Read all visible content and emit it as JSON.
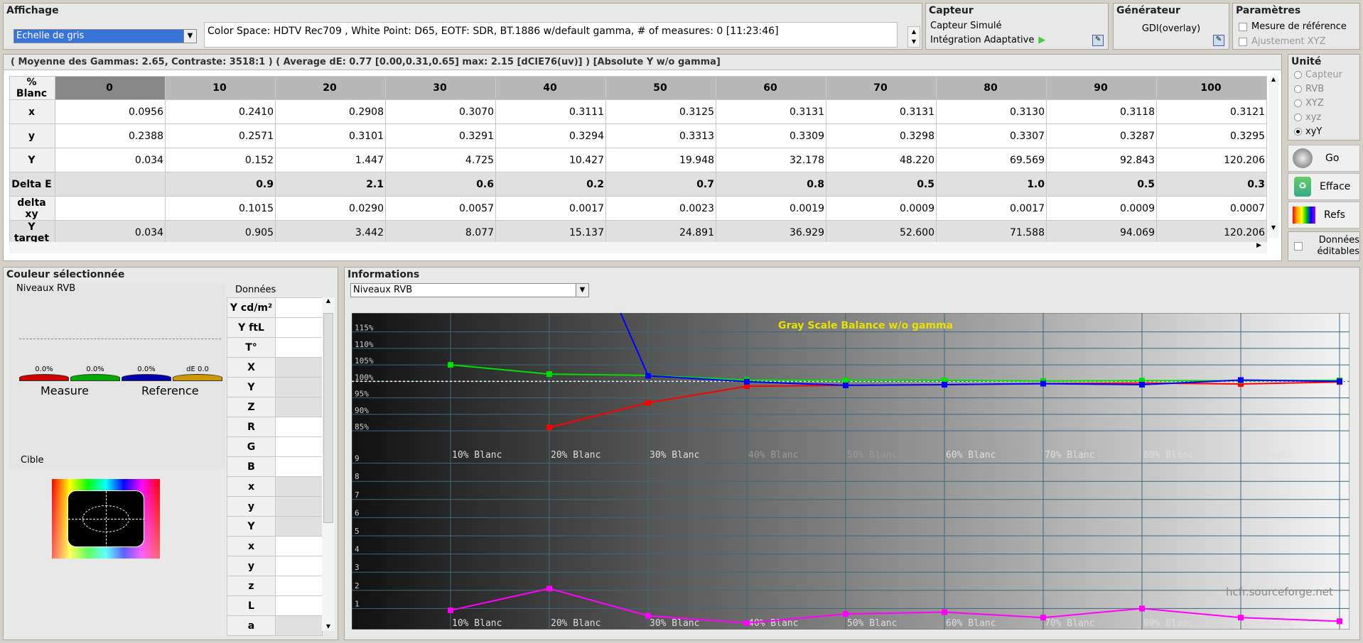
{
  "affichage": {
    "title": "Affichage",
    "combo": "Echelle de gris",
    "info": "Color Space: HDTV Rec709 , White Point: D65, EOTF:  SDR, BT.1886 w/default gamma, # of measures: 0 [11:23:46]"
  },
  "capteur": {
    "title": "Capteur",
    "line1": "Capteur Simulé",
    "line2": "Intégration Adaptative"
  },
  "generateur": {
    "title": "Générateur",
    "value": "GDI(overlay)"
  },
  "parametres": {
    "title": "Paramètres",
    "opt1": "Mesure de référence",
    "opt2": "Ajustement XYZ"
  },
  "summary": "( Moyenne des Gammas: 2.65, Contraste: 3518:1 ) ( Average dE: 0.77 [0.00,0.31,0.65] max: 2.15 [dCIE76(uv)] ) [Absolute Y w/o gamma]",
  "table": {
    "corner": "% Blanc",
    "cols": [
      "0",
      "10",
      "20",
      "30",
      "40",
      "50",
      "60",
      "70",
      "80",
      "90",
      "100"
    ],
    "rows": [
      {
        "h": "x",
        "v": [
          "0.0956",
          "0.2410",
          "0.2908",
          "0.3070",
          "0.3111",
          "0.3125",
          "0.3131",
          "0.3131",
          "0.3130",
          "0.3118",
          "0.3121"
        ]
      },
      {
        "h": "y",
        "v": [
          "0.2388",
          "0.2571",
          "0.3101",
          "0.3291",
          "0.3294",
          "0.3313",
          "0.3309",
          "0.3298",
          "0.3307",
          "0.3287",
          "0.3295"
        ]
      },
      {
        "h": "Y",
        "v": [
          "0.034",
          "0.152",
          "1.447",
          "4.725",
          "10.427",
          "19.948",
          "32.178",
          "48.220",
          "69.569",
          "92.843",
          "120.206"
        ]
      },
      {
        "h": "Delta E",
        "v": [
          "",
          "0.9",
          "2.1",
          "0.6",
          "0.2",
          "0.7",
          "0.8",
          "0.5",
          "1.0",
          "0.5",
          "0.3"
        ]
      },
      {
        "h": "delta xy",
        "v": [
          "",
          "0.1015",
          "0.0290",
          "0.0057",
          "0.0017",
          "0.0023",
          "0.0019",
          "0.0009",
          "0.0017",
          "0.0009",
          "0.0007"
        ]
      },
      {
        "h": "Y target",
        "v": [
          "0.034",
          "0.905",
          "3.442",
          "8.077",
          "15.137",
          "24.891",
          "36.929",
          "52.600",
          "71.588",
          "94.069",
          "120.206"
        ]
      }
    ]
  },
  "unite": {
    "title": "Unité",
    "opts": [
      "Capteur",
      "RVB",
      "XYZ",
      "xyz",
      "xyY"
    ],
    "selected": 4
  },
  "buttons": {
    "go": "Go",
    "efface": "Efface",
    "refs": "Refs",
    "donnees": "Données éditables"
  },
  "couleur": {
    "title": "Couleur sélectionnée",
    "niveaux": "Niveaux RVB",
    "donnees": "Données",
    "bar_labels": [
      "0.0%",
      "0.0%",
      "0.0%",
      "dE 0.0"
    ],
    "measure": "Measure",
    "reference": "Reference",
    "cible": "Cible",
    "data_keys": [
      "Y cd/m²",
      "Y ftL",
      "T°",
      "X",
      "Y",
      "Z",
      "R",
      "G",
      "B",
      "x",
      "y",
      "Y",
      "x",
      "y",
      "z",
      "L",
      "a"
    ]
  },
  "informations": {
    "title": "Informations",
    "combo": "Niveaux RVB"
  },
  "colors": {
    "red": "#ff0000",
    "green": "#00e000",
    "blue": "#0000ff",
    "magenta": "#ff00ff",
    "title": "#e8e000"
  },
  "chart_data": {
    "type": "line",
    "title": "Gray Scale Balance w/o gamma",
    "watermark": "hcfr.sourceforge.net",
    "x": [
      10,
      20,
      30,
      40,
      50,
      60,
      70,
      80,
      90,
      100
    ],
    "x_tick_labels": [
      "10% Blanc",
      "20% Blanc",
      "30% Blanc",
      "40% Blanc",
      "50% Blanc",
      "60% Blanc",
      "70% Blanc",
      "80% Blanc",
      "90% Blanc"
    ],
    "upper": {
      "y_ticks": [
        "115%",
        "110%",
        "105%",
        "100%",
        "95%",
        "90%",
        "85%"
      ],
      "ylim": [
        82,
        119
      ],
      "series": [
        {
          "color": "red",
          "values": [
            null,
            86,
            93.5,
            98.5,
            98.8,
            99.0,
            99.3,
            99.5,
            99.2,
            99.8
          ]
        },
        {
          "color": "green",
          "values": [
            105,
            102.2,
            101.8,
            100.4,
            100.3,
            100.3,
            100.1,
            100.2,
            100.2,
            100.3
          ]
        },
        {
          "color": "blue",
          "values": [
            null,
            170,
            101.7,
            99.9,
            98.8,
            99.0,
            99.3,
            99.0,
            100.4,
            100.0
          ]
        }
      ]
    },
    "lower": {
      "y_ticks": [
        "9",
        "8",
        "7",
        "6",
        "5",
        "4",
        "3",
        "2",
        "1"
      ],
      "ylim": [
        0,
        10
      ],
      "series": [
        {
          "color": "magenta",
          "values": [
            0.9,
            2.1,
            0.6,
            0.2,
            0.7,
            0.8,
            0.5,
            1.0,
            0.5,
            0.3
          ]
        }
      ]
    }
  }
}
